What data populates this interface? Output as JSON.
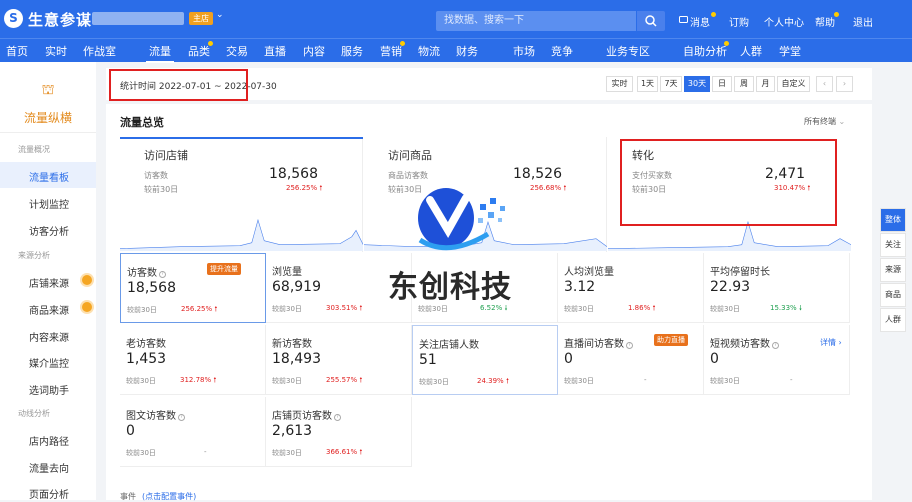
{
  "app": {
    "logo_glyph": "S",
    "title": "生意参谋",
    "shop_badge": "主店",
    "caret": "⌄"
  },
  "search": {
    "placeholder": "找数据、搜索一下"
  },
  "top_links": [
    {
      "label": "消息"
    },
    {
      "label": "订购"
    },
    {
      "label": "个人中心"
    },
    {
      "label": "帮助"
    },
    {
      "label": "退出"
    }
  ],
  "nav": {
    "items": [
      "首页",
      "实时",
      "作战室",
      "流量",
      "品类",
      "交易",
      "直播",
      "内容",
      "服务",
      "营销",
      "物流",
      "财务",
      "市场",
      "竞争",
      "业务专区",
      "自助分析",
      "人群",
      "学堂"
    ],
    "active": "流量"
  },
  "sidebar": {
    "logo_glyph": "⛫",
    "title": "流量纵横",
    "groups": [
      {
        "label": "流量概况",
        "items": [
          "流量看板",
          "计划监控",
          "访客分析"
        ]
      },
      {
        "label": "来源分析",
        "items": [
          "店铺来源",
          "商品来源",
          "内容来源",
          "媒介监控",
          "选词助手"
        ]
      },
      {
        "label": "动线分析",
        "items": [
          "店内路径",
          "流量去向",
          "页面分析"
        ]
      }
    ]
  },
  "datebar": {
    "range_label": "统计时间 2022-07-01 ~ 2022-07-30",
    "periods": [
      "实时",
      "1天",
      "7天",
      "30天",
      "日",
      "周",
      "月",
      "自定义"
    ],
    "active_period": "30天",
    "prev": "‹",
    "next": "›"
  },
  "overview": {
    "title": "流量总览",
    "term_select": "所有终端",
    "cards": [
      {
        "name": "访问店铺",
        "sub": "访客数",
        "value": "18,568",
        "compare": "较前30日",
        "pct": "256.25%",
        "trend": "up"
      },
      {
        "name": "访问商品",
        "sub": "商品访客数",
        "value": "18,526",
        "compare": "较前30日",
        "pct": "256.68%",
        "trend": "up"
      },
      {
        "name": "转化",
        "sub": "支付买家数",
        "value": "2,471",
        "compare": "较前30日",
        "pct": "310.47%",
        "trend": "up"
      }
    ],
    "metrics": [
      {
        "name": "访客数",
        "value": "18,568",
        "compare": "较前30日",
        "pct": "256.25%",
        "trend": "up",
        "badge": "提升流量",
        "info": true
      },
      {
        "name": "浏览量",
        "value": "68,919",
        "compare": "较前30日",
        "pct": "303.51%",
        "trend": "up"
      },
      {
        "name": "",
        "value": "",
        "compare": "较前30日",
        "pct": "6.52%",
        "trend": "down"
      },
      {
        "name": "人均浏览量",
        "value": "3.12",
        "compare": "较前30日",
        "pct": "1.86%",
        "trend": "up"
      },
      {
        "name": "平均停留时长",
        "value": "22.93",
        "compare": "较前30日",
        "pct": "15.33%",
        "trend": "down"
      },
      {
        "name": "老访客数",
        "value": "1,453",
        "compare": "较前30日",
        "pct": "312.78%",
        "trend": "up"
      },
      {
        "name": "新访客数",
        "value": "18,493",
        "compare": "较前30日",
        "pct": "255.57%",
        "trend": "up"
      },
      {
        "name": "关注店铺人数",
        "value": "51",
        "compare": "较前30日",
        "pct": "24.39%",
        "trend": "up"
      },
      {
        "name": "直播间访客数",
        "value": "0",
        "compare": "较前30日",
        "pct": "-",
        "badge": "助力直播",
        "info": true
      },
      {
        "name": "短视频访客数",
        "value": "0",
        "compare": "较前30日",
        "pct": "-",
        "link": "详情 ›",
        "info": true
      },
      {
        "name": "图文访客数",
        "value": "0",
        "compare": "较前30日",
        "pct": "-",
        "info": true
      },
      {
        "name": "店铺页访客数",
        "value": "2,613",
        "compare": "较前30日",
        "pct": "366.61%",
        "trend": "up",
        "info": true
      }
    ]
  },
  "rightbar": {
    "items": [
      "整体",
      "关注",
      "来源",
      "商品",
      "人群"
    ],
    "active": "整体"
  },
  "bottom": {
    "label": "事件",
    "link": "(点击配置事件)"
  },
  "watermark": {
    "text": "东创科技"
  },
  "colors": {
    "brand": "#2b6de8",
    "up": "#e02020",
    "down": "#20a050",
    "highlight_box": "#e02020",
    "accent_orange": "#e38a1c"
  }
}
